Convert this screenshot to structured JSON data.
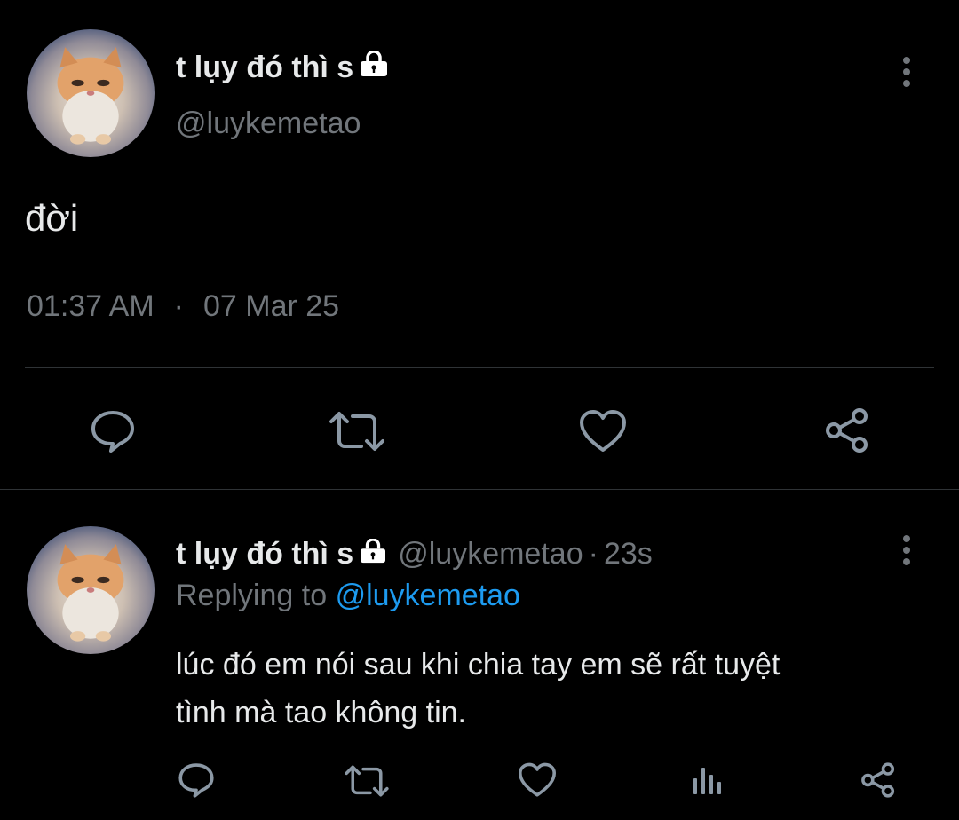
{
  "main_tweet": {
    "display_name": "t lụy đó thì s",
    "handle": "@luykemetao",
    "text": "đời",
    "time": "01:37 AM",
    "separator": "·",
    "date": "07 Mar 25"
  },
  "reply_tweet": {
    "display_name": "t lụy đó thì s",
    "handle": "@luykemetao",
    "dot": "·",
    "age": "23s",
    "replying_prefix": "Replying to",
    "replying_to": "@luykemetao",
    "text_line1": "lúc đó em nói sau khi chia tay em sẽ rất tuyệt",
    "text_line2": "tình mà tao không tin."
  },
  "icons": {
    "lock": "lock-icon",
    "more": "more-vertical-icon",
    "reply": "reply-icon",
    "retweet": "retweet-icon",
    "like": "heart-icon",
    "views": "analytics-icon",
    "share": "share-icon"
  },
  "colors": {
    "background": "#000000",
    "primary_text": "#e7e9ea",
    "secondary_text": "#71767b",
    "link": "#1d9bf0",
    "divider": "#2f3336"
  }
}
